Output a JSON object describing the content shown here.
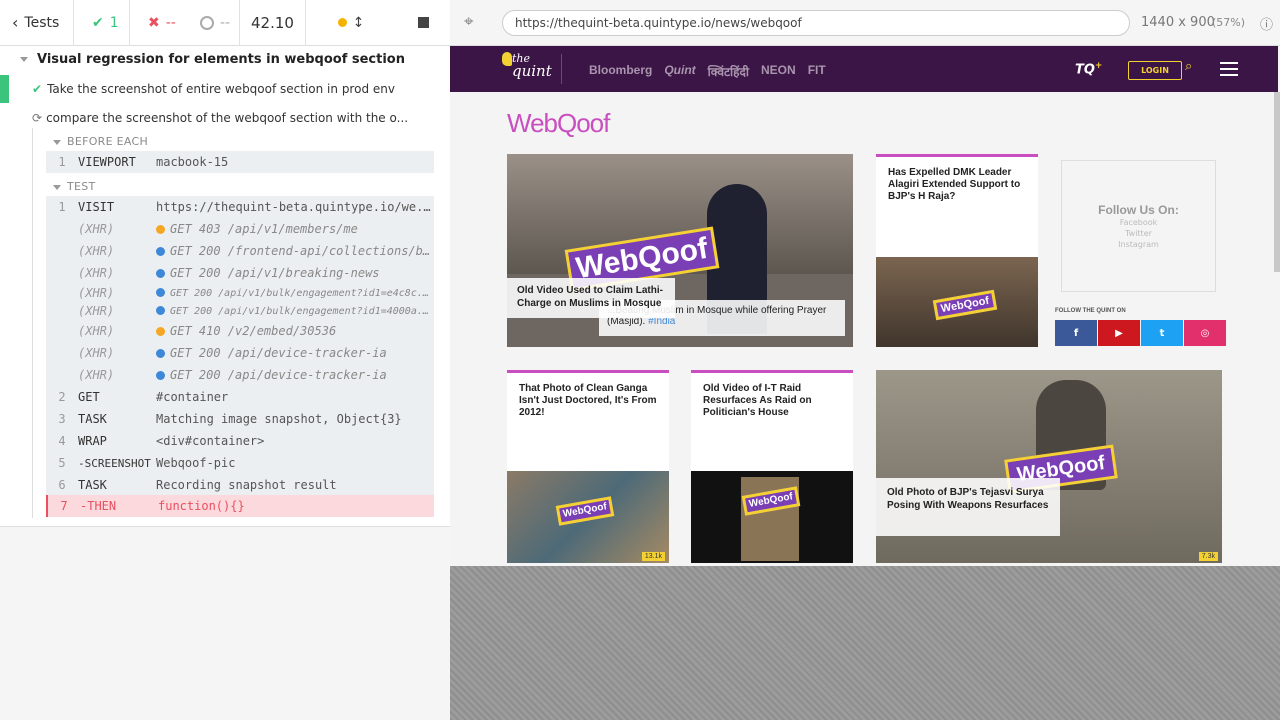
{
  "header": {
    "tests_label": "Tests",
    "passed_count": "1",
    "failed_count": "--",
    "pending_count": "--",
    "duration": "42.10"
  },
  "reporter": {
    "suite_title": "Visual regression for elements in webqoof section",
    "tests": [
      {
        "title": "Take the screenshot of entire webqoof section in prod env",
        "state": "passed"
      },
      {
        "title": "compare the screenshot of the webqoof section with the o...",
        "state": "running"
      }
    ],
    "before_each_label": "BEFORE EACH",
    "test_label": "TEST",
    "before_each": [
      {
        "num": "1",
        "name": "VIEWPORT",
        "message": "macbook-15"
      }
    ],
    "commands": [
      {
        "num": "1",
        "name": "VISIT",
        "message": "https://thequint-beta.quintype.io/we...",
        "kind": "cmd"
      },
      {
        "num": "",
        "name": "(XHR)",
        "message": "GET 403 /api/v1/members/me",
        "kind": "xhr",
        "dot": "or"
      },
      {
        "num": "",
        "name": "(XHR)",
        "message": "GET 200 /frontend-api/collections/b...",
        "kind": "xhr",
        "dot": "bl"
      },
      {
        "num": "",
        "name": "(XHR)",
        "message": "GET 200 /api/v1/breaking-news",
        "kind": "xhr",
        "dot": "bl"
      },
      {
        "num": "",
        "name": "(XHR)",
        "message": "GET 200 /api/v1/bulk/engagement?id1=e4c8c...",
        "kind": "xhr small",
        "dot": "bl"
      },
      {
        "num": "",
        "name": "(XHR)",
        "message": "GET 200 /api/v1/bulk/engagement?id1=4000a...",
        "kind": "xhr small",
        "dot": "bl"
      },
      {
        "num": "",
        "name": "(XHR)",
        "message": "GET 410 /v2/embed/30536",
        "kind": "xhr",
        "dot": "or"
      },
      {
        "num": "",
        "name": "(XHR)",
        "message": "GET 200 /api/device-tracker-ia",
        "kind": "xhr",
        "dot": "bl"
      },
      {
        "num": "",
        "name": "(XHR)",
        "message": "GET 200 /api/device-tracker-ia",
        "kind": "xhr",
        "dot": "bl"
      },
      {
        "num": "2",
        "name": "GET",
        "message": "#container",
        "kind": "cmd"
      },
      {
        "num": "3",
        "name": "TASK",
        "message": "Matching image snapshot, Object{3}",
        "kind": "cmd"
      },
      {
        "num": "4",
        "name": "WRAP",
        "message": "<div#container>",
        "kind": "cmd"
      },
      {
        "num": "5",
        "name": "-SCREENSHOT",
        "message": "Webqoof-pic",
        "kind": "cmd"
      },
      {
        "num": "6",
        "name": "TASK",
        "message": "Recording snapshot result",
        "kind": "cmd"
      },
      {
        "num": "7",
        "name": "-THEN",
        "message": "function(){}",
        "kind": "fail"
      }
    ]
  },
  "urlbar": {
    "url": "https://thequint-beta.quintype.io/news/webqoof",
    "viewport": "1440 x 900",
    "scale": "(57%)"
  },
  "site": {
    "logo_line1": "the",
    "logo_line2": "quint",
    "partners": [
      "Bloomberg",
      "Quint",
      "क्विंटहिंदी",
      "NEON",
      "FIT"
    ],
    "tq": "TQ",
    "login": "LOGIN",
    "section_title": "WebQoof",
    "hero_title": "Old Video Used to Claim Lathi-Charge on Muslims in Mosque",
    "hero_overlay": "...Beating Muslim in Mosque while offering Prayer (Masjid).",
    "hero_overlay_tag": "#India",
    "card2_title": "Has Expelled DMK Leader Alagiri Extended Support to BJP's H Raja?",
    "follow_title": "Follow Us On:",
    "follow_links": [
      "Facebook",
      "Twitter",
      "Instagram"
    ],
    "follow_label": "FOLLOW THE QUINT ON",
    "social": [
      {
        "icon": "f",
        "color": "#3b5998"
      },
      {
        "icon": "▶",
        "color": "#cc181e"
      },
      {
        "icon": "t",
        "color": "#1da1f2"
      },
      {
        "icon": "◎",
        "color": "#e1306c"
      }
    ],
    "card3_title": "That Photo of Clean Ganga Isn't Just Doctored, It's From 2012!",
    "card3_count": "13.1k",
    "card4_title": "Old Video of I-T Raid Resurfaces As Raid on Politician's House",
    "card5_title": "Old Photo of BJP's Tejasvi Surya Posing With Weapons Resurfaces",
    "card5_count": "7.3k",
    "stamp": "WebQoof"
  }
}
